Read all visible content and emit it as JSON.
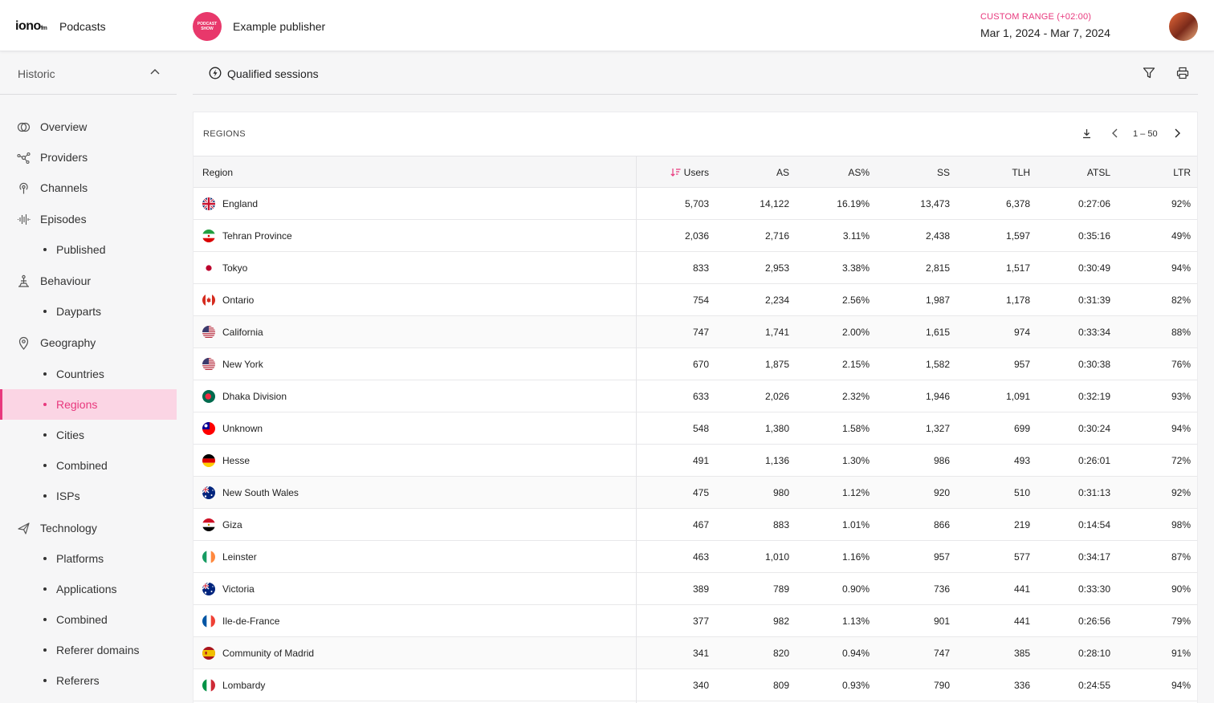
{
  "header": {
    "logo_text": "iono",
    "logo_suffix": "fm",
    "app_name": "Podcasts",
    "publisher_avatar_text": "PODCAST SHOW",
    "publisher_name": "Example publisher",
    "range_label": "CUSTOM RANGE (+02:00)",
    "range_value": "Mar 1, 2024 - Mar 7, 2024",
    "accent_color": "#e8387d"
  },
  "sidebar": {
    "section": "Historic",
    "items": [
      {
        "label": "Overview",
        "icon": "overview-icon"
      },
      {
        "label": "Providers",
        "icon": "providers-icon"
      },
      {
        "label": "Channels",
        "icon": "channels-icon"
      },
      {
        "label": "Episodes",
        "icon": "episodes-icon"
      },
      {
        "label": "Published"
      },
      {
        "label": "Behaviour",
        "icon": "behaviour-icon"
      },
      {
        "label": "Dayparts"
      },
      {
        "label": "Geography",
        "icon": "geography-icon"
      },
      {
        "label": "Countries"
      },
      {
        "label": "Regions",
        "active": true
      },
      {
        "label": "Cities"
      },
      {
        "label": "Combined"
      },
      {
        "label": "ISPs"
      },
      {
        "label": "Technology",
        "icon": "technology-icon"
      },
      {
        "label": "Platforms"
      },
      {
        "label": "Applications"
      },
      {
        "label": "Combined"
      },
      {
        "label": "Referer domains"
      },
      {
        "label": "Referers"
      }
    ]
  },
  "toolbar": {
    "title": "Qualified sessions",
    "filter_icon": "filter-icon",
    "print_icon": "print-icon"
  },
  "table": {
    "title": "REGIONS",
    "page_range": "1 – 50",
    "headers": {
      "region": "Region",
      "users": "Users",
      "as": "AS",
      "asp": "AS%",
      "ss": "SS",
      "tlh": "TLH",
      "atsl": "ATSL",
      "ltr": "LTR"
    },
    "sorted_column": "Users",
    "rows": [
      {
        "flag": "gb",
        "region": "England",
        "users": "5,703",
        "as": "14,122",
        "asp": "16.19%",
        "ss": "13,473",
        "tlh": "6,378",
        "atsl": "0:27:06",
        "ltr": "92%"
      },
      {
        "flag": "ir",
        "region": "Tehran Province",
        "users": "2,036",
        "as": "2,716",
        "asp": "3.11%",
        "ss": "2,438",
        "tlh": "1,597",
        "atsl": "0:35:16",
        "ltr": "49%"
      },
      {
        "flag": "jp",
        "region": "Tokyo",
        "users": "833",
        "as": "2,953",
        "asp": "3.38%",
        "ss": "2,815",
        "tlh": "1,517",
        "atsl": "0:30:49",
        "ltr": "94%"
      },
      {
        "flag": "ca",
        "region": "Ontario",
        "users": "754",
        "as": "2,234",
        "asp": "2.56%",
        "ss": "1,987",
        "tlh": "1,178",
        "atsl": "0:31:39",
        "ltr": "82%"
      },
      {
        "flag": "us",
        "region": "California",
        "users": "747",
        "as": "1,741",
        "asp": "2.00%",
        "ss": "1,615",
        "tlh": "974",
        "atsl": "0:33:34",
        "ltr": "88%"
      },
      {
        "flag": "us",
        "region": "New York",
        "users": "670",
        "as": "1,875",
        "asp": "2.15%",
        "ss": "1,582",
        "tlh": "957",
        "atsl": "0:30:38",
        "ltr": "76%"
      },
      {
        "flag": "bd",
        "region": "Dhaka Division",
        "users": "633",
        "as": "2,026",
        "asp": "2.32%",
        "ss": "1,946",
        "tlh": "1,091",
        "atsl": "0:32:19",
        "ltr": "93%"
      },
      {
        "flag": "tw",
        "region": "Unknown",
        "users": "548",
        "as": "1,380",
        "asp": "1.58%",
        "ss": "1,327",
        "tlh": "699",
        "atsl": "0:30:24",
        "ltr": "94%"
      },
      {
        "flag": "de",
        "region": "Hesse",
        "users": "491",
        "as": "1,136",
        "asp": "1.30%",
        "ss": "986",
        "tlh": "493",
        "atsl": "0:26:01",
        "ltr": "72%"
      },
      {
        "flag": "au",
        "region": "New South Wales",
        "users": "475",
        "as": "980",
        "asp": "1.12%",
        "ss": "920",
        "tlh": "510",
        "atsl": "0:31:13",
        "ltr": "92%"
      },
      {
        "flag": "eg",
        "region": "Giza",
        "users": "467",
        "as": "883",
        "asp": "1.01%",
        "ss": "866",
        "tlh": "219",
        "atsl": "0:14:54",
        "ltr": "98%"
      },
      {
        "flag": "ie",
        "region": "Leinster",
        "users": "463",
        "as": "1,010",
        "asp": "1.16%",
        "ss": "957",
        "tlh": "577",
        "atsl": "0:34:17",
        "ltr": "87%"
      },
      {
        "flag": "au",
        "region": "Victoria",
        "users": "389",
        "as": "789",
        "asp": "0.90%",
        "ss": "736",
        "tlh": "441",
        "atsl": "0:33:30",
        "ltr": "90%"
      },
      {
        "flag": "fr",
        "region": "Ile-de-France",
        "users": "377",
        "as": "982",
        "asp": "1.13%",
        "ss": "901",
        "tlh": "441",
        "atsl": "0:26:56",
        "ltr": "79%"
      },
      {
        "flag": "es",
        "region": "Community of Madrid",
        "users": "341",
        "as": "820",
        "asp": "0.94%",
        "ss": "747",
        "tlh": "385",
        "atsl": "0:28:10",
        "ltr": "91%"
      },
      {
        "flag": "it",
        "region": "Lombardy",
        "users": "340",
        "as": "809",
        "asp": "0.93%",
        "ss": "790",
        "tlh": "336",
        "atsl": "0:24:55",
        "ltr": "94%"
      }
    ]
  }
}
